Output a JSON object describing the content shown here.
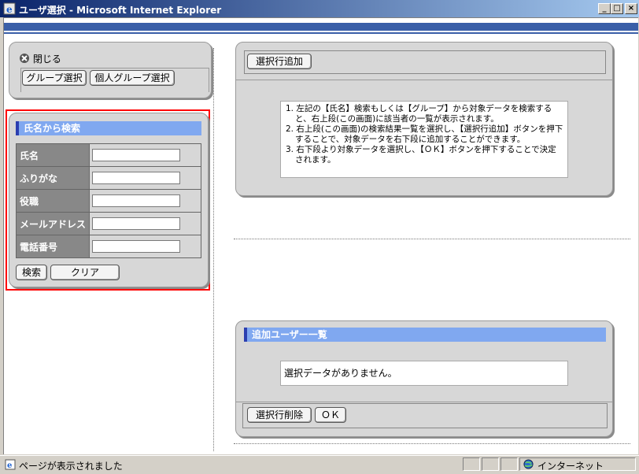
{
  "window": {
    "title": "ユーザ選択 - Microsoft Internet Explorer",
    "min": "_",
    "max": "□",
    "close": "×"
  },
  "left_top": {
    "close_label": "閉じる",
    "group_select": "グループ選択",
    "personal_group_select": "個人グループ選択"
  },
  "search": {
    "header": "氏名から検索",
    "fields": [
      {
        "label": "氏名",
        "value": ""
      },
      {
        "label": "ふりがな",
        "value": ""
      },
      {
        "label": "役職",
        "value": ""
      },
      {
        "label": "メールアドレス",
        "value": ""
      },
      {
        "label": "電話番号",
        "value": ""
      }
    ],
    "search_button": "検索",
    "clear_button": "クリア"
  },
  "right_top": {
    "add_row_button": "選択行追加",
    "instructions": [
      "1. 左記の【氏名】検索もしくは【グループ】から対象データを検索すると、右上段(この画面)に該当者の一覧が表示されます。",
      "2. 右上段(この画面)の検索結果一覧を選択し、【選択行追加】ボタンを押下することで、対象データを右下段に追加することができます。",
      "3. 右下段より対象データを選択し、【ＯＫ】ボタンを押下することで決定されます。"
    ]
  },
  "right_bottom": {
    "header": "追加ユーザー一覧",
    "empty_message": "選択データがありません。",
    "delete_button": "選択行削除",
    "ok_button": "ＯＫ"
  },
  "statusbar": {
    "message": "ページが表示されました",
    "zone": "インターネット"
  },
  "colors": {
    "highlight": "#ff0000",
    "section_header": "#80a8f0",
    "band": "#3a5fa8"
  }
}
